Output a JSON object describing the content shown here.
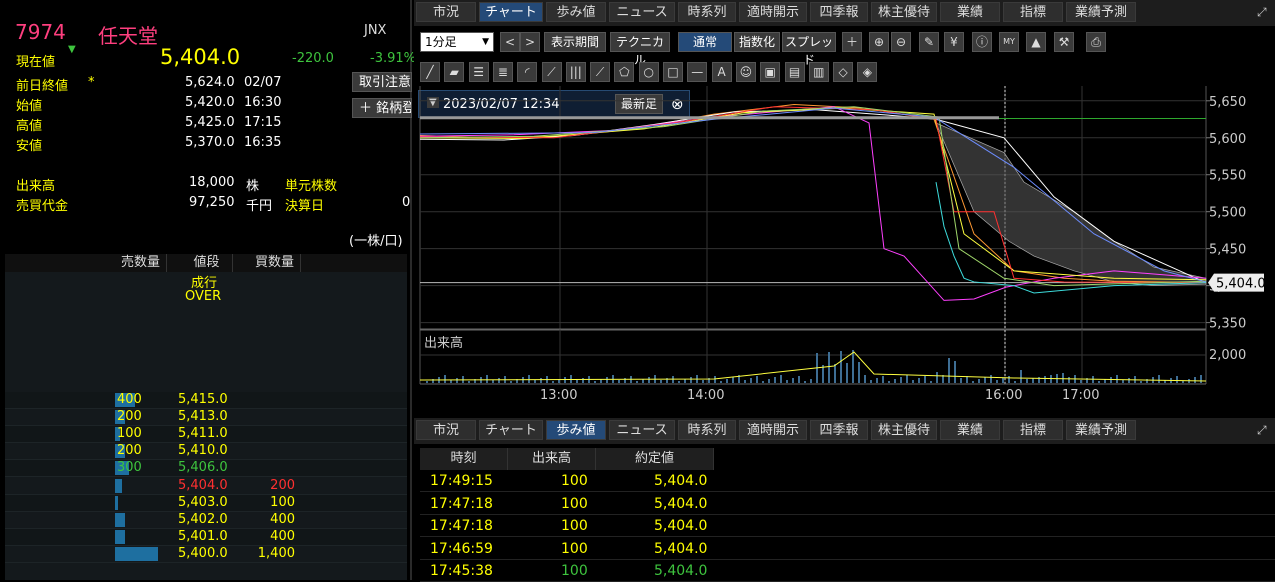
{
  "stock": {
    "code": "7974",
    "name": "任天堂",
    "market": "JNX",
    "current_label": "現在値",
    "current_price": "5,404.0",
    "change": "-220.0",
    "change_pct": "-3.91%",
    "prev_close_label": "前日終値",
    "prev_close_mark": "*",
    "prev_close": "5,624.0",
    "prev_close_date": "02/07",
    "open_label": "始値",
    "open": "5,420.0",
    "open_time": "16:30",
    "high_label": "高値",
    "high": "5,425.0",
    "high_time": "17:15",
    "low_label": "安値",
    "low": "5,370.0",
    "low_time": "16:35",
    "volume_label": "出来高",
    "volume": "18,000",
    "volume_unit": "株",
    "unit_shares_label": "単元株数",
    "turnover_label": "売買代金",
    "turnover": "97,250",
    "turnover_unit": "千円",
    "settle_label": "決算日",
    "settle_value": "0",
    "trade_note_btn": "取引注意",
    "add_btn": "銘柄登録",
    "per_share_note": "(一株/口)"
  },
  "orderbook": {
    "headers": [
      "売数量",
      "値段",
      "買数量"
    ],
    "market_label": "成行",
    "over_label": "OVER",
    "rows": [
      {
        "sell": "400",
        "price": "5,415.0",
        "buy": "",
        "sell_ratio": 0.25,
        "buy_ratio": 0
      },
      {
        "sell": "200",
        "price": "5,413.0",
        "buy": "",
        "sell_ratio": 0.12,
        "buy_ratio": 0
      },
      {
        "sell": "100",
        "price": "5,411.0",
        "buy": "",
        "sell_ratio": 0.06,
        "buy_ratio": 0
      },
      {
        "sell": "200",
        "price": "5,410.0",
        "buy": "",
        "sell_ratio": 0.12,
        "buy_ratio": 0
      },
      {
        "sell": "300",
        "price": "5,406.0",
        "buy": "",
        "sell_ratio": 0.18,
        "buy_ratio": 0
      },
      {
        "sell": "",
        "price": "5,404.0",
        "buy": "200",
        "sell_ratio": 0,
        "buy_ratio": 0.08
      },
      {
        "sell": "",
        "price": "5,403.0",
        "buy": "100",
        "sell_ratio": 0,
        "buy_ratio": 0.04
      },
      {
        "sell": "",
        "price": "5,402.0",
        "buy": "400",
        "sell_ratio": 0,
        "buy_ratio": 0.12
      },
      {
        "sell": "",
        "price": "5,401.0",
        "buy": "400",
        "sell_ratio": 0,
        "buy_ratio": 0.12
      },
      {
        "sell": "",
        "price": "5,400.0",
        "buy": "1,400",
        "sell_ratio": 0,
        "buy_ratio": 0.5
      }
    ]
  },
  "tabs": [
    "市況",
    "チャート",
    "歩み値",
    "ニュース",
    "時系列",
    "適時開示",
    "四季報",
    "株主優待",
    "業績",
    "指標",
    "業績予測"
  ],
  "toolbar": {
    "interval": "1分足",
    "period_btn": "表示期間",
    "technical_btn": "テクニカル",
    "normal_btn": "通常",
    "index_btn": "指数化",
    "spread_btn": "スプレッド"
  },
  "chart": {
    "date_box": "2023/02/07 12:34",
    "latest_btn": "最新足",
    "current_tag": "5,404.0",
    "volume_label": "出来高",
    "volume_tick": "2,000",
    "colors": {
      "up": "#3ec43e",
      "down": "#ff3030",
      "accent": "#244a78"
    }
  },
  "chart_data": {
    "type": "line",
    "x": [
      "13:00",
      "14:00",
      "16:00",
      "17:00"
    ],
    "price_ticks": [
      "5,650",
      "5,600",
      "5,550",
      "5,500",
      "5,450",
      "5,400",
      "5,350"
    ],
    "ylim": [
      5340,
      5670
    ],
    "current": 5404,
    "series": [
      {
        "name": "",
        "values": [
          5600,
          5605,
          5640,
          5630,
          5405,
          5404
        ]
      }
    ]
  },
  "timesales": {
    "headers": [
      "時刻",
      "出来高",
      "約定値"
    ],
    "rows": [
      {
        "time": "17:49:15",
        "qty": "100",
        "price": "5,404.0",
        "color": "#ffff00"
      },
      {
        "time": "17:47:18",
        "qty": "100",
        "price": "5,404.0",
        "color": "#ffff00"
      },
      {
        "time": "17:47:18",
        "qty": "100",
        "price": "5,404.0",
        "color": "#ffff00"
      },
      {
        "time": "17:46:59",
        "qty": "100",
        "price": "5,404.0",
        "color": "#ffff00"
      },
      {
        "time": "17:45:38",
        "qty": "100",
        "price": "5,404.0",
        "color": "#3ec43e"
      }
    ]
  }
}
